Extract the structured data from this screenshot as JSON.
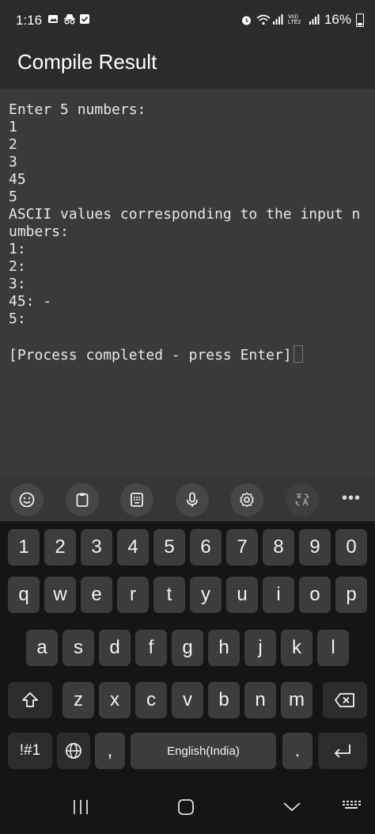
{
  "status_bar": {
    "time": "1:16",
    "network_lte": "Vo)) LTE2",
    "battery": "16%",
    "icons": [
      "image-icon",
      "incognito-icon",
      "checkbox-icon",
      "alarm-icon",
      "wifi-icon",
      "signal-icon",
      "signal-icon-2",
      "battery-icon"
    ]
  },
  "app_bar": {
    "title": "Compile Result"
  },
  "terminal": {
    "lines": [
      "Enter 5 numbers:",
      "1",
      "2",
      "3",
      "45",
      "5",
      "ASCII values corresponding to the input n",
      "umbers:",
      "1:",
      "2:",
      "3:",
      "45: -",
      "5:",
      "",
      "[Process completed - press Enter]"
    ]
  },
  "keyboard_toolbar": {
    "buttons": [
      "emoji-icon",
      "clipboard-icon",
      "keyboard-mode-icon",
      "microphone-icon",
      "settings-icon",
      "translate-icon"
    ],
    "more": "•••"
  },
  "keyboard": {
    "number_row": [
      "1",
      "2",
      "3",
      "4",
      "5",
      "6",
      "7",
      "8",
      "9",
      "0"
    ],
    "row1": [
      "q",
      "w",
      "e",
      "r",
      "t",
      "y",
      "u",
      "i",
      "o",
      "p"
    ],
    "row2": [
      "a",
      "s",
      "d",
      "f",
      "g",
      "h",
      "j",
      "k",
      "l"
    ],
    "row3": [
      "z",
      "x",
      "c",
      "v",
      "b",
      "n",
      "m"
    ],
    "symbols_label": "!#1",
    "comma": ",",
    "space_label": "English(India)",
    "period": "."
  },
  "nav_bar": {
    "icons": [
      "recent-apps-icon",
      "home-icon",
      "back-icon",
      "keyboard-hide-icon"
    ]
  }
}
